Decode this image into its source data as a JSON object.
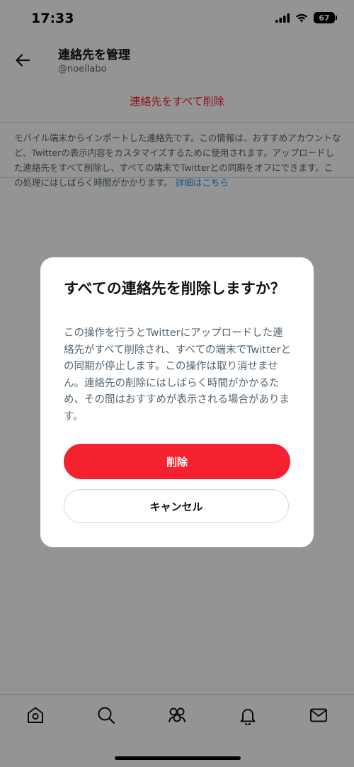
{
  "status_bar": {
    "time": "17:33",
    "battery": "67"
  },
  "header": {
    "title": "連絡先を管理",
    "handle": "@noellabo"
  },
  "page": {
    "delete_all_label": "連絡先をすべて削除",
    "description": "モバイル端末からインポートした連絡先です。この情報は、おすすめアカウントなど、Twitterの表示内容をカスタマイズするために使用されます。アップロードした連絡先をすべて削除し、すべての端末でTwitterとの同期をオフにできます。この処理にはしばらく時間がかかります。",
    "learn_more_link": "詳細はこちら"
  },
  "dialog": {
    "title": "すべての連絡先を削除しますか？",
    "body": "この操作を行うとTwitterにアップロードした連絡先がすべて削除され、すべての端末でTwitterとの同期が停止します。この操作は取り消せません。連絡先の削除にはしばらく時間がかかるため、その間はおすすめが表示される場合があります。",
    "confirm_label": "削除",
    "cancel_label": "キャンセル"
  },
  "tabbar": {
    "icons": [
      "home-icon",
      "search-icon",
      "communities-icon",
      "notifications-icon",
      "messages-icon"
    ]
  },
  "colors": {
    "danger": "#f4212e",
    "link": "#1d9bf0",
    "overlay": "rgba(0,0,0,0.42)"
  }
}
